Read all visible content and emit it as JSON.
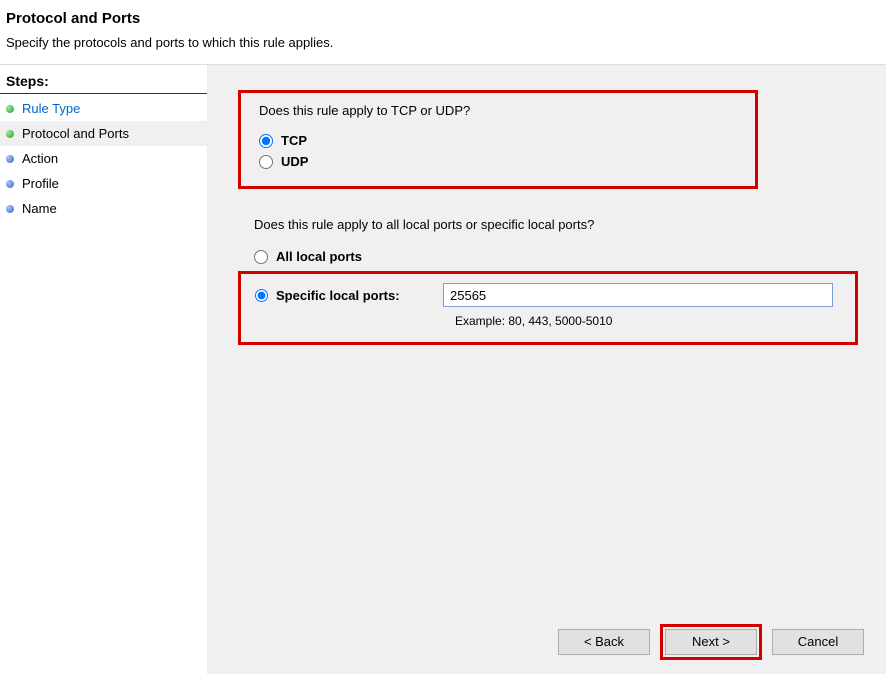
{
  "header": {
    "title": "Protocol and Ports",
    "description": "Specify the protocols and ports to which this rule applies."
  },
  "sidebar": {
    "title": "Steps:",
    "items": [
      {
        "label": "Rule Type",
        "bullet": "green",
        "link": true
      },
      {
        "label": "Protocol and Ports",
        "bullet": "green",
        "link": false,
        "current": true
      },
      {
        "label": "Action",
        "bullet": "blue",
        "link": false
      },
      {
        "label": "Profile",
        "bullet": "blue",
        "link": false
      },
      {
        "label": "Name",
        "bullet": "blue",
        "link": false
      }
    ]
  },
  "protocol": {
    "question": "Does this rule apply to TCP or UDP?",
    "tcp_label": "TCP",
    "udp_label": "UDP",
    "selected": "tcp"
  },
  "ports": {
    "question": "Does this rule apply to all local ports or specific local ports?",
    "all_label": "All local ports",
    "specific_label": "Specific local ports:",
    "port_value": "25565",
    "example": "Example: 80, 443, 5000-5010",
    "selected": "specific"
  },
  "buttons": {
    "back": "< Back",
    "next": "Next >",
    "cancel": "Cancel"
  }
}
